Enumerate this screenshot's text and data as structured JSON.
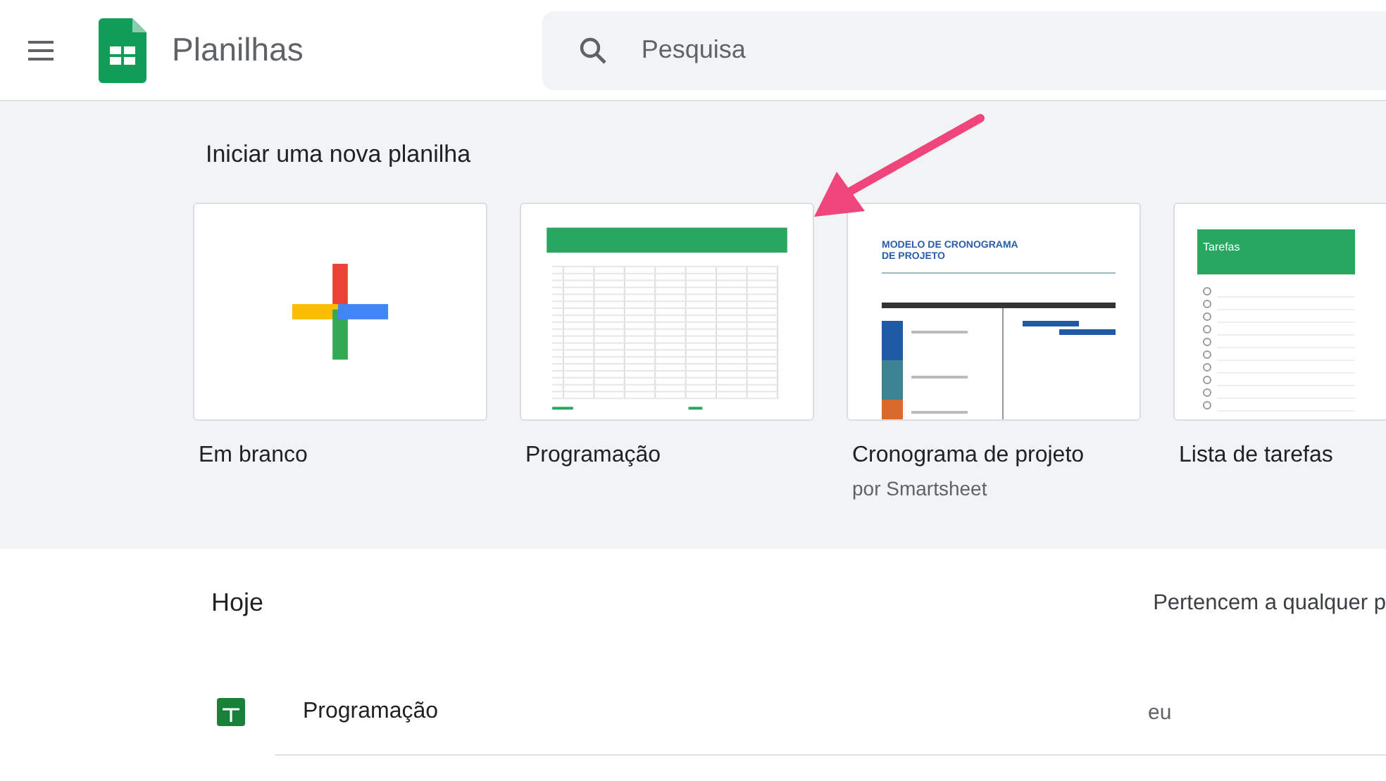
{
  "app": {
    "title": "Planilhas"
  },
  "search": {
    "placeholder": "Pesquisa"
  },
  "templates_section": {
    "title": "Iniciar uma nova planilha",
    "templates": [
      {
        "kind": "blank",
        "label": "Em branco"
      },
      {
        "kind": "schedule",
        "label": "Programação"
      },
      {
        "kind": "gantt",
        "label": "Cronograma de projeto",
        "subtitle": "por Smartsheet",
        "thumbnail_title": "MODELO DE CRONOGRAMA DE PROJETO"
      },
      {
        "kind": "todo",
        "label": "Lista de tarefas",
        "thumbnail_title": "Tarefas"
      }
    ]
  },
  "recent": {
    "title": "Hoje",
    "owner_filter": "Pertencem a qualquer p",
    "files": [
      {
        "name": "Programação",
        "owner": "eu"
      }
    ]
  }
}
